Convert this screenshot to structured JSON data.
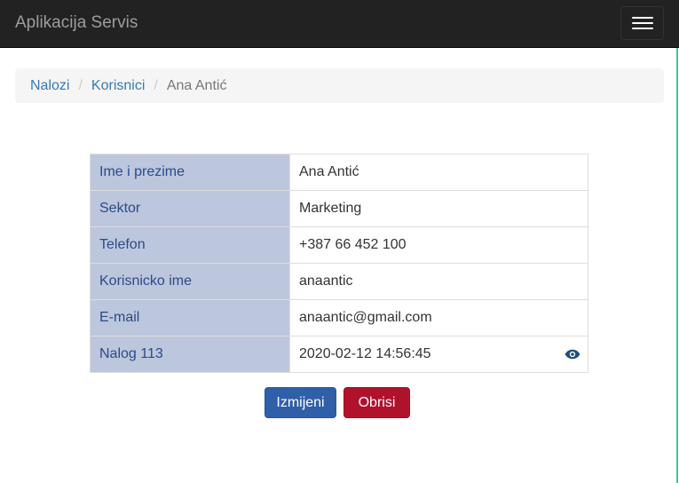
{
  "navbar": {
    "brand": "Aplikacija Servis"
  },
  "breadcrumb": {
    "items": [
      "Nalozi",
      "Korisnici"
    ],
    "active": "Ana Antić",
    "separator": "/"
  },
  "details": {
    "rows": [
      {
        "label": "Ime i prezime",
        "value": "Ana Antić"
      },
      {
        "label": "Sektor",
        "value": "Marketing"
      },
      {
        "label": "Telefon",
        "value": "+387 66 452 100"
      },
      {
        "label": "Korisnicko ime",
        "value": "anaantic"
      },
      {
        "label": "E-mail",
        "value": "anaantic@gmail.com"
      },
      {
        "label": "Nalog 113",
        "value": "2020-02-12 14:56:45",
        "icon": "eye-icon"
      }
    ]
  },
  "actions": {
    "edit_label": "Izmijeni",
    "delete_label": "Obrisi"
  },
  "colors": {
    "navbar": "#222222",
    "label_bg": "#bcc6dc",
    "label_text": "#2a4b8a",
    "primary": "#2e5fa8",
    "danger": "#b0122c",
    "link": "#337ab7"
  }
}
